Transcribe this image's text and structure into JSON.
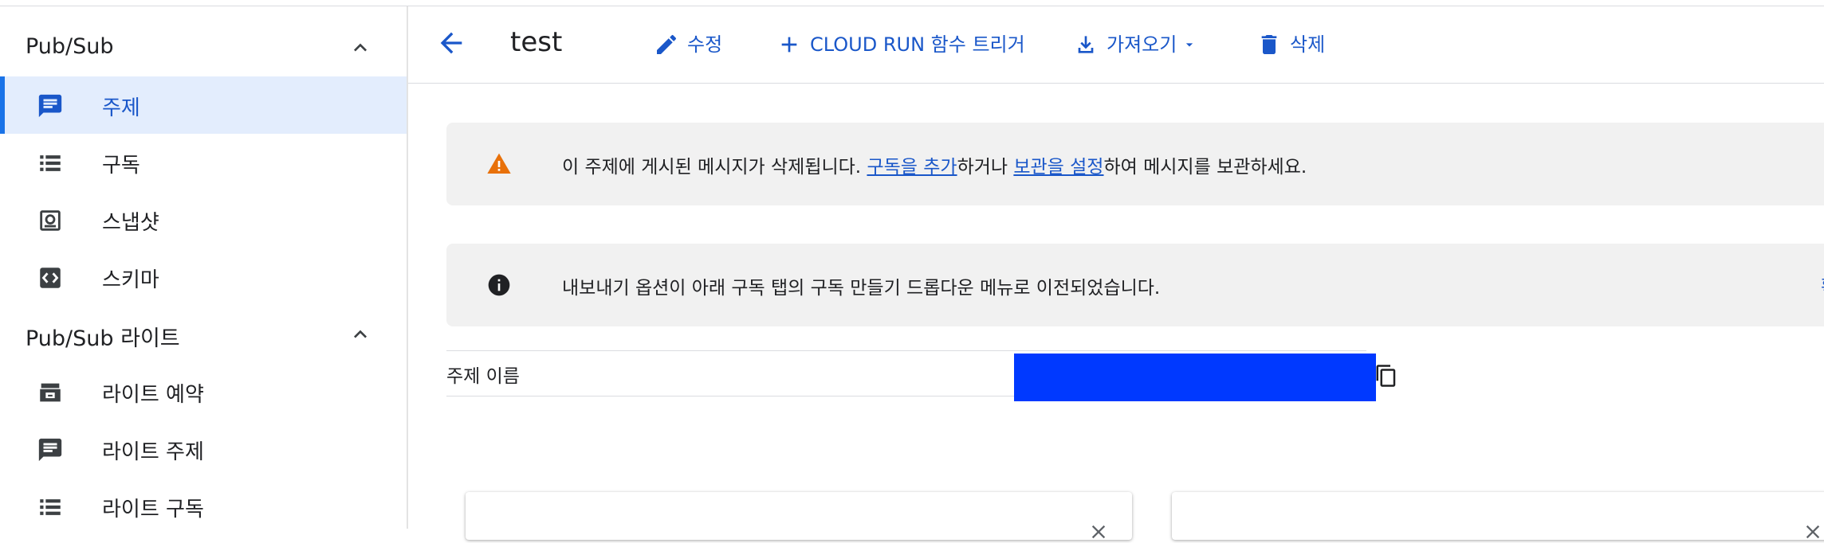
{
  "sidebar": {
    "sections": [
      {
        "title": "Pub/Sub"
      },
      {
        "title": "Pub/Sub 라이트"
      }
    ],
    "items": [
      {
        "label": "주제",
        "icon": "message-icon",
        "active": true
      },
      {
        "label": "구독",
        "icon": "list-icon"
      },
      {
        "label": "스냅샷",
        "icon": "snapshot-icon"
      },
      {
        "label": "스키마",
        "icon": "code-icon"
      },
      {
        "label": "라이트 예약",
        "icon": "reservation-icon"
      },
      {
        "label": "라이트 주제",
        "icon": "message-icon"
      },
      {
        "label": "라이트 구독",
        "icon": "list-icon"
      }
    ]
  },
  "header": {
    "title": "test",
    "actions": {
      "edit": "수정",
      "trigger": "CLOUD RUN 함수 트리거",
      "import": "가져오기",
      "delete": "삭제"
    }
  },
  "warning_banner": {
    "text_before": "이 주제에 게시된 메시지가 삭제됩니다. ",
    "link1": "구독을 추가",
    "text_middle": "하거나 ",
    "link2": "보관을 설정",
    "text_after": "하여 메시지를 보관하세요."
  },
  "info_banner": {
    "text": "내보내기 옵션이 아래 구독 탭의 구독 만들기 드롭다운 메뉴로 이전되었습니다.",
    "confirm": "확인"
  },
  "topic_name": {
    "label": "주제 이름",
    "value": ""
  },
  "colors": {
    "accent": "#1a73e8",
    "link": "#1a57c9",
    "warning": "#e8710a",
    "redaction": "#0039ff"
  }
}
